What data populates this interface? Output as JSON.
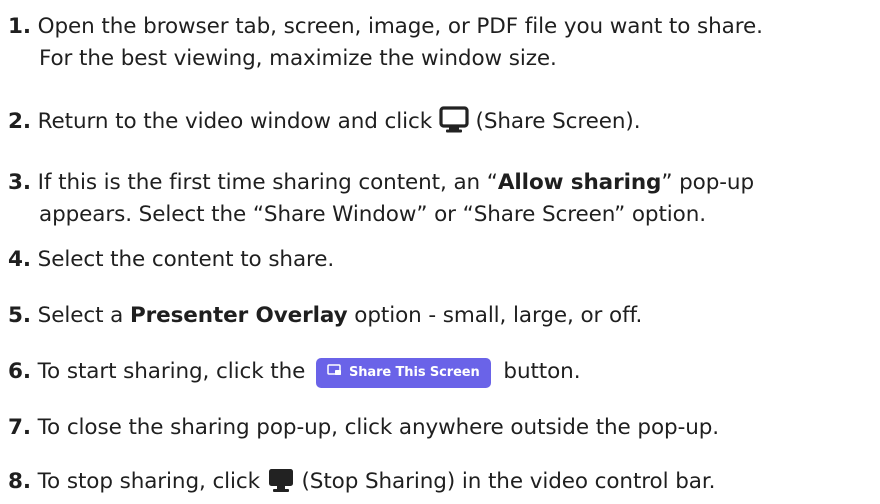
{
  "steps": [
    {
      "num": "1.",
      "line1": "Open the browser tab, screen, image, or PDF file you want to share.",
      "line2": "For the best viewing, maximize the window size."
    },
    {
      "num": "2.",
      "pre": "Return to the video window and click",
      "icon": "share-screen-icon",
      "post": "(Share Screen)."
    },
    {
      "num": "3.",
      "pre": "If this is the first time sharing content, an “",
      "bold": "Allow sharing",
      "post": "” pop-up",
      "line2": "appears. Select the “Share Window” or “Share Screen” option."
    },
    {
      "num": "4.",
      "text": "Select the content to share."
    },
    {
      "num": "5.",
      "pre": "Select a",
      "bold": "Presenter Overlay",
      "post": "option - small, large, or off."
    },
    {
      "num": "6.",
      "pre": "To start sharing, click the",
      "button_label": "Share This Screen",
      "button_icon": "screen-share-icon",
      "post": "button."
    },
    {
      "num": "7.",
      "text": "To close the sharing pop-up, click anywhere outside the pop-up."
    },
    {
      "num": "8.",
      "pre": "To stop sharing, click",
      "icon": "stop-sharing-icon",
      "post": "(Stop Sharing) in the video control bar."
    }
  ],
  "colors": {
    "text": "#1f1f1f",
    "button_bg": "#6a63e8",
    "button_text": "#ffffff",
    "icon": "#222222"
  }
}
